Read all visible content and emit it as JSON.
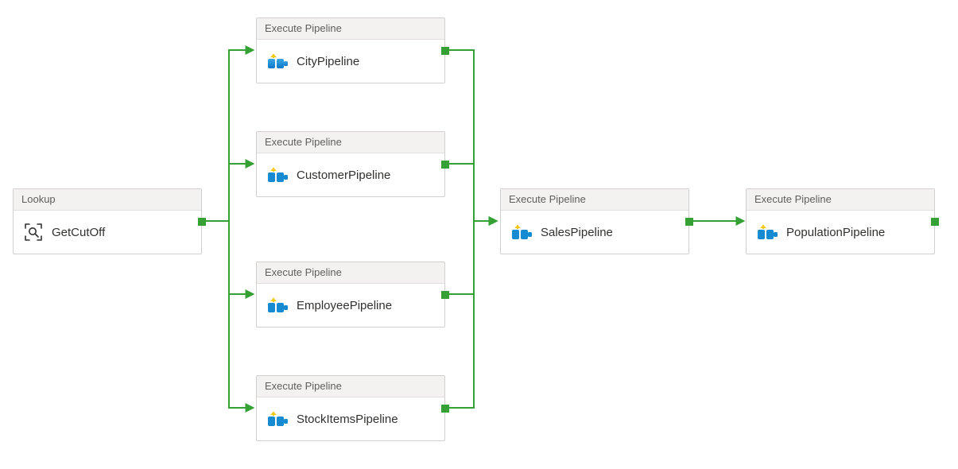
{
  "colors": {
    "connector": "#35a135",
    "port": "#35a135",
    "nodeBorder": "#d2d0ce",
    "headerBg": "#f3f2f1",
    "headerText": "#605e5c",
    "bodyText": "#323130"
  },
  "activities": {
    "lookup": {
      "type_label": "Lookup",
      "name": "GetCutOff"
    },
    "parallel": [
      {
        "type_label": "Execute Pipeline",
        "name": "CityPipeline"
      },
      {
        "type_label": "Execute Pipeline",
        "name": "CustomerPipeline"
      },
      {
        "type_label": "Execute Pipeline",
        "name": "EmployeePipeline"
      },
      {
        "type_label": "Execute Pipeline",
        "name": "StockItemsPipeline"
      }
    ],
    "sales": {
      "type_label": "Execute Pipeline",
      "name": "SalesPipeline"
    },
    "population": {
      "type_label": "Execute Pipeline",
      "name": "PopulationPipeline"
    }
  }
}
